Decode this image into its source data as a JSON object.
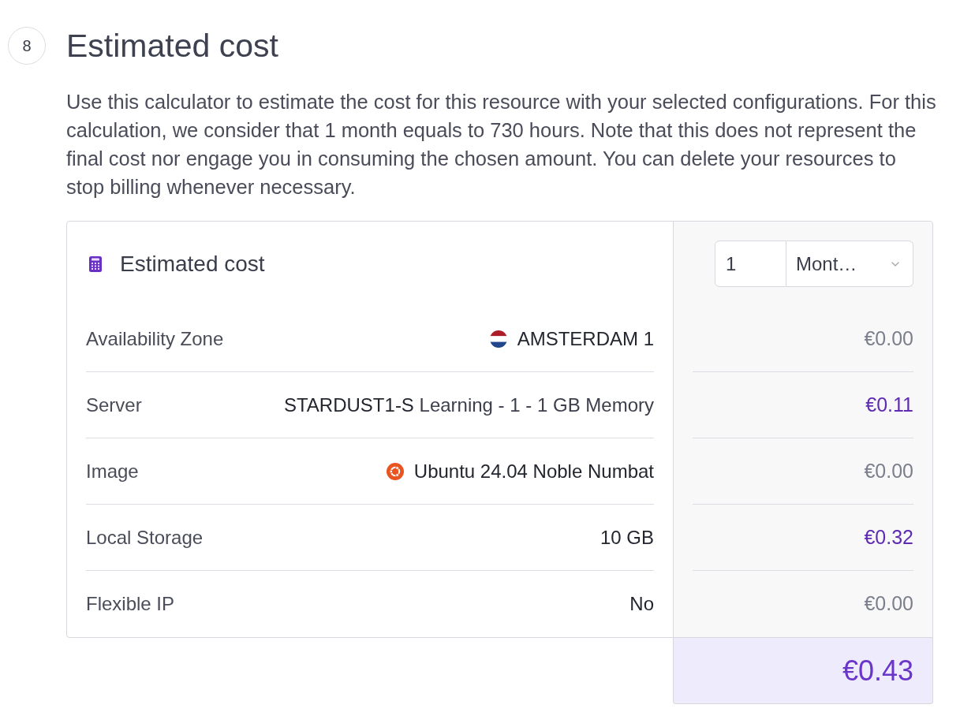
{
  "step": {
    "number": "8",
    "title": "Estimated cost"
  },
  "description": "Use this calculator to estimate the cost for this resource with your selected configurations. For this calculation, we consider that 1 month equals to 730 hours. Note that this does not represent the final cost nor engage you in consuming the chosen amount. You can delete your resources to stop billing whenever necessary.",
  "calculator": {
    "title": "Estimated cost",
    "period": {
      "amount": "1",
      "unit": "Mont…"
    },
    "rows": [
      {
        "kind": "zone",
        "label": "Availability Zone",
        "value": "AMSTERDAM 1",
        "price": "€0.00",
        "highlighted": false
      },
      {
        "kind": "text",
        "label": "Server",
        "value": "STARDUST1-S",
        "detail": "Learning - 1 - 1 GB Memory",
        "price": "€0.11",
        "highlighted": true
      },
      {
        "kind": "image",
        "label": "Image",
        "value": "Ubuntu 24.04 Noble Numbat",
        "price": "€0.00",
        "highlighted": false
      },
      {
        "kind": "text",
        "label": "Local Storage",
        "value": "10 GB",
        "price": "€0.32",
        "highlighted": true
      },
      {
        "kind": "text",
        "label": "Flexible IP",
        "value": "No",
        "price": "€0.00",
        "highlighted": false
      }
    ],
    "total": "€0.43"
  }
}
